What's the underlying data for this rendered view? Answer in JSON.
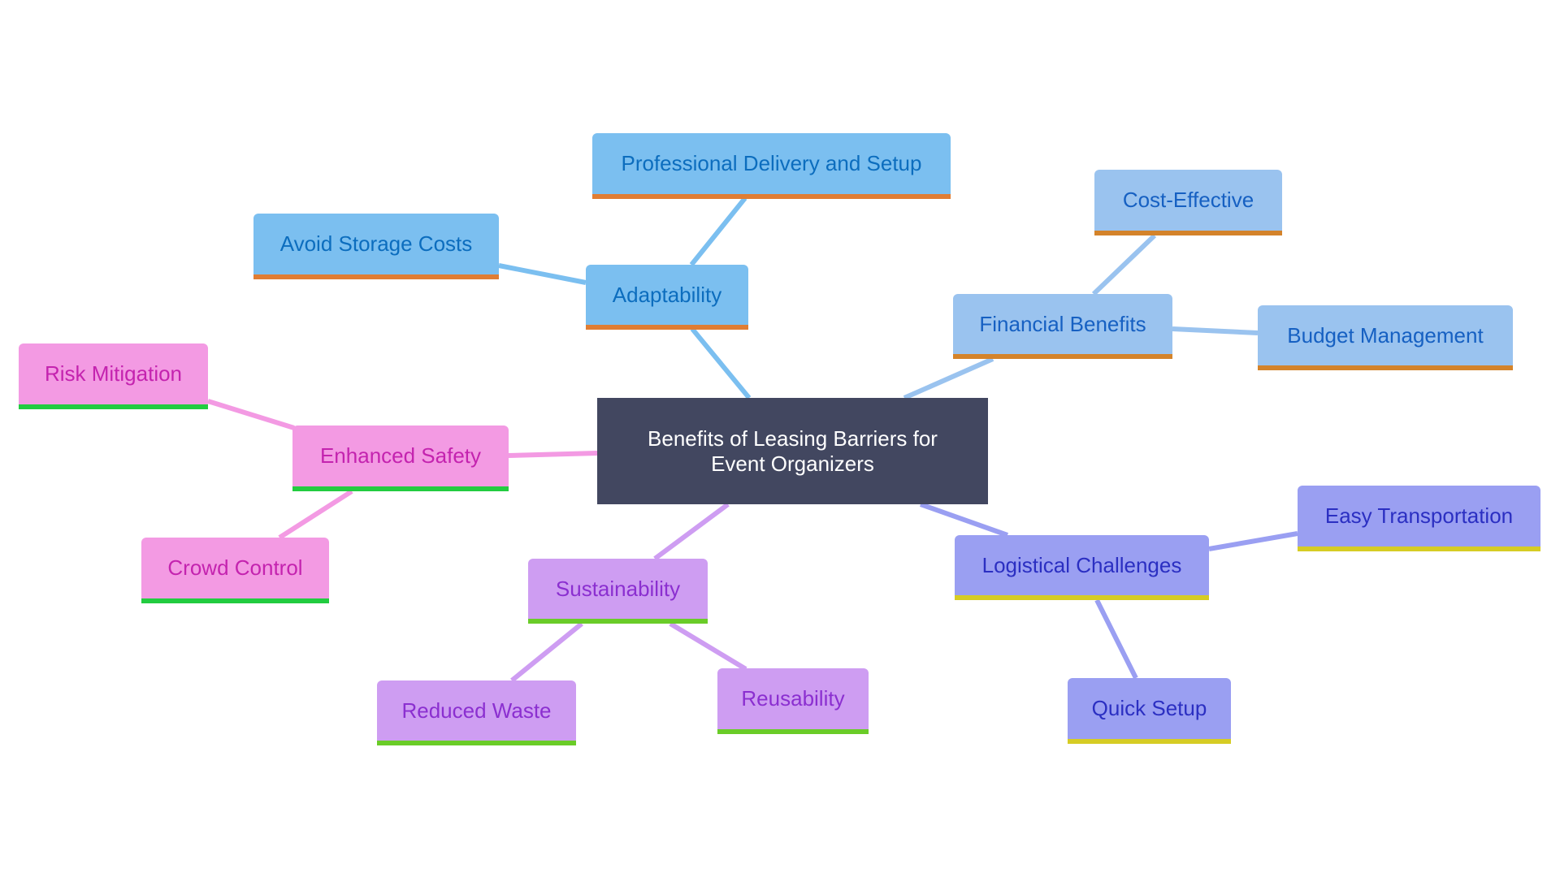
{
  "diagram": {
    "type": "mindmap",
    "root": {
      "id": "root",
      "label_line1": "Benefits of Leasing Barriers for",
      "label_line2": "Event Organizers",
      "fill": "#424760",
      "text": "#FFFFFF"
    },
    "branches": [
      {
        "id": "adaptability",
        "label": "Adaptability",
        "fill": "#7BBFF0",
        "text": "#0C6DBE",
        "edge": "#7BBFF0",
        "bar": "#E07D33",
        "children": [
          {
            "id": "professional-delivery",
            "label": "Professional Delivery and Setup"
          },
          {
            "id": "avoid-storage-costs",
            "label": "Avoid Storage Costs"
          }
        ]
      },
      {
        "id": "financial-benefits",
        "label": "Financial Benefits",
        "fill": "#9AC3EF",
        "text": "#1660C2",
        "edge": "#9AC3EF",
        "bar": "#D4832A",
        "children": [
          {
            "id": "cost-effective",
            "label": "Cost-Effective"
          },
          {
            "id": "budget-management",
            "label": "Budget Management"
          }
        ]
      },
      {
        "id": "enhanced-safety",
        "label": "Enhanced Safety",
        "fill": "#F39AE3",
        "text": "#C423AF",
        "edge": "#F39AE3",
        "bar": "#22CC40",
        "children": [
          {
            "id": "risk-mitigation",
            "label": "Risk Mitigation"
          },
          {
            "id": "crowd-control",
            "label": "Crowd Control"
          }
        ]
      },
      {
        "id": "sustainability",
        "label": "Sustainability",
        "fill": "#CE9DF2",
        "text": "#8B2FD0",
        "edge": "#CE9DF2",
        "bar": "#6ACC28",
        "children": [
          {
            "id": "reduced-waste",
            "label": "Reduced Waste"
          },
          {
            "id": "reusability",
            "label": "Reusability"
          }
        ]
      },
      {
        "id": "logistical-challenges",
        "label": "Logistical Challenges",
        "fill": "#9A9FF2",
        "text": "#2B2FC2",
        "edge": "#9A9FF2",
        "bar": "#D6CC24",
        "children": [
          {
            "id": "easy-transportation",
            "label": "Easy Transportation"
          },
          {
            "id": "quick-setup",
            "label": "Quick Setup"
          }
        ]
      }
    ]
  }
}
